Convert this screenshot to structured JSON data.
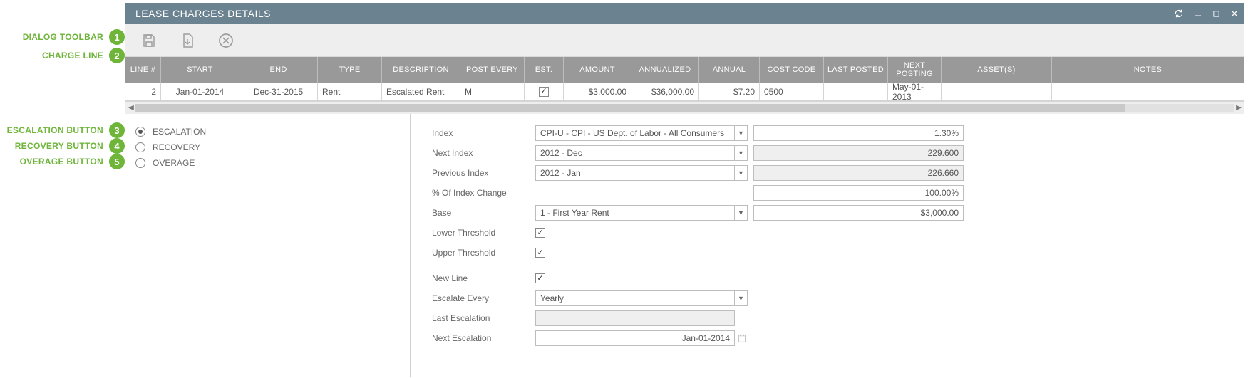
{
  "callouts": {
    "c1": "DIALOG TOOLBAR",
    "c2": "CHARGE LINE",
    "c3": "ESCALATION BUTTON",
    "c4": "RECOVERY BUTTON",
    "c5": "OVERAGE BUTTON",
    "n1": "1",
    "n2": "2",
    "n3": "3",
    "n4": "4",
    "n5": "5"
  },
  "title": "LEASE CHARGES DETAILS",
  "grid": {
    "headers": {
      "line": "LINE #",
      "start": "START",
      "end": "END",
      "type": "TYPE",
      "desc": "DESCRIPTION",
      "post": "POST EVERY",
      "est": "EST.",
      "amt": "AMOUNT",
      "annz": "ANNUALIZED",
      "ann": "ANNUAL",
      "cost": "COST CODE",
      "lpost": "LAST POSTED",
      "next": "NEXT POSTING",
      "asset": "ASSET(S)",
      "notes": "NOTES"
    },
    "row": {
      "line": "2",
      "start": "Jan-01-2014",
      "end": "Dec-31-2015",
      "type": "Rent",
      "desc": "Escalated Rent",
      "post": "M",
      "est_checked": "✓",
      "amt": "$3,000.00",
      "annz": "$36,000.00",
      "ann": "$7.20",
      "cost": "0500",
      "lpost": "",
      "next": "May-01-2013",
      "asset": "",
      "notes": ""
    }
  },
  "radios": {
    "escalation": "ESCALATION",
    "recovery": "RECOVERY",
    "overage": "OVERAGE"
  },
  "form": {
    "labels": {
      "index": "Index",
      "next_index": "Next Index",
      "prev_index": "Previous Index",
      "pct_change": "% Of Index Change",
      "base": "Base",
      "lower": "Lower Threshold",
      "upper": "Upper Threshold",
      "newline": "New Line",
      "esc_every": "Escalate Every",
      "last_esc": "Last Escalation",
      "next_esc": "Next Escalation"
    },
    "index_select": "CPI-U - CPI - US Dept. of Labor - All Consumers",
    "index_value": "1.30%",
    "next_index_select": "2012 - Dec",
    "next_index_value": "229.600",
    "prev_index_select": "2012 - Jan",
    "prev_index_value": "226.660",
    "pct_change_value": "100.00%",
    "base_select": "1 - First Year Rent",
    "base_value": "$3,000.00",
    "lower_checked": "✓",
    "upper_checked": "✓",
    "newline_checked": "✓",
    "esc_every_select": "Yearly",
    "last_esc_value": "",
    "next_esc_value": "Jan-01-2014"
  }
}
